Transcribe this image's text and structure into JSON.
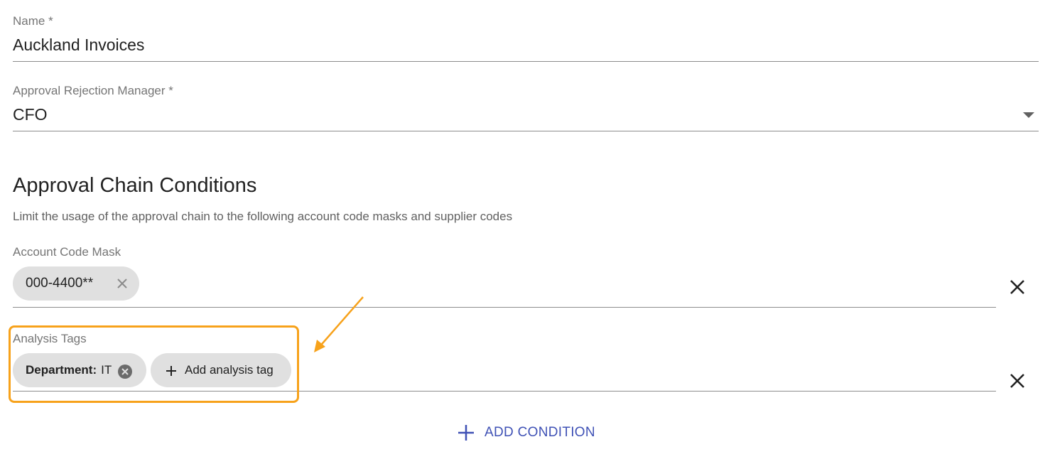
{
  "form": {
    "name": {
      "label": "Name *",
      "value": "Auckland Invoices"
    },
    "manager": {
      "label": "Approval Rejection Manager *",
      "value": "CFO"
    }
  },
  "conditions": {
    "heading": "Approval Chain Conditions",
    "description": "Limit the usage of the approval chain to the following account code masks and supplier codes",
    "account_code_mask": {
      "label": "Account Code Mask",
      "chips": [
        {
          "text": "000-4400**"
        }
      ]
    },
    "analysis_tags": {
      "label": "Analysis Tags",
      "chips": [
        {
          "key": "Department:",
          "value": "IT"
        }
      ],
      "add_label": "Add analysis tag"
    },
    "add_condition_label": "ADD CONDITION"
  },
  "colors": {
    "highlight": "#f7a21b",
    "accent": "#3f51b5",
    "chip_bg": "#e0e0e0"
  },
  "icons": {
    "dropdown": "caret-down-icon",
    "remove_row": "close-icon",
    "chip_remove": "close-icon",
    "chip_remove_filled": "close-circle-icon",
    "add": "plus-icon",
    "annotation": "arrow-icon"
  }
}
